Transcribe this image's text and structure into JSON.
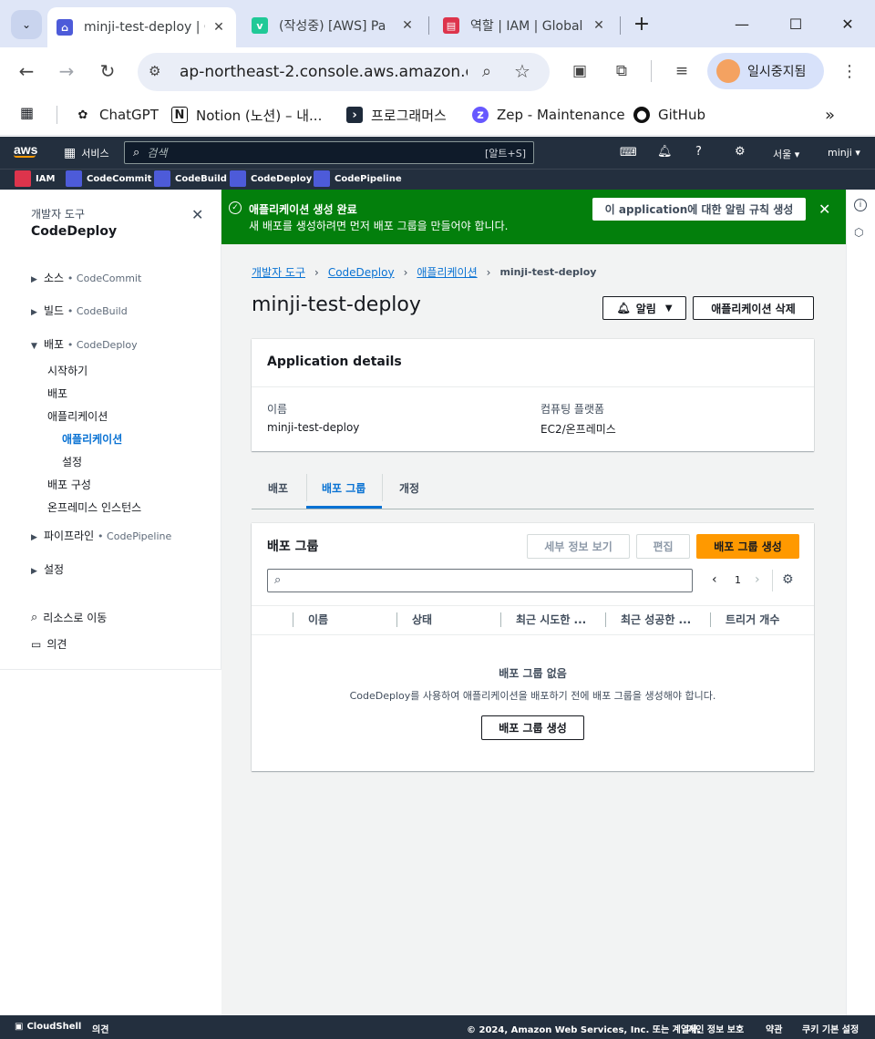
{
  "browser": {
    "tabs": [
      {
        "title": "minji-test-deploy | CodeDeploy",
        "active": true
      },
      {
        "title": "(작성중) [AWS] Pa"
      },
      {
        "title": "역할 | IAM | Global"
      }
    ],
    "url": "ap-northeast-2.console.aws.amazon.c...",
    "profile_label": "일시중지됨",
    "bookmarks": [
      {
        "label": "ChatGPT"
      },
      {
        "label": "Notion (노션) – 내..."
      },
      {
        "label": "프로그래머스"
      },
      {
        "label": "Zep - Maintenance"
      },
      {
        "label": "GitHub"
      }
    ]
  },
  "aws_header": {
    "logo": "aws",
    "services_label": "서비스",
    "search_placeholder": "검색",
    "search_shortcut": "[알트+S]",
    "region": "서울 ▾",
    "user": "minji ▾"
  },
  "favorites": [
    {
      "label": "IAM",
      "color": "#dd344c"
    },
    {
      "label": "CodeCommit",
      "color": "#4d5bd9"
    },
    {
      "label": "CodeBuild",
      "color": "#4d5bd9"
    },
    {
      "label": "CodeDeploy",
      "color": "#4d5bd9"
    },
    {
      "label": "CodePipeline",
      "color": "#4d5bd9"
    }
  ],
  "sidenav": {
    "eyebrow": "개발자 도구",
    "title": "CodeDeploy",
    "sections": [
      {
        "label": "소스",
        "sub": "CodeCommit"
      },
      {
        "label": "빌드",
        "sub": "CodeBuild"
      },
      {
        "label": "배포",
        "sub": "CodeDeploy"
      }
    ],
    "deploy_items": [
      "시작하기",
      "배포",
      "애플리케이션"
    ],
    "app_subitems": [
      "애플리케이션",
      "설정"
    ],
    "deploy_items2": [
      "배포 구성",
      "온프레미스 인스턴스"
    ],
    "sections2": [
      {
        "label": "파이프라인",
        "sub": "CodePipeline"
      },
      {
        "label": "설정",
        "sub": ""
      }
    ],
    "goto": "리소스로 이동",
    "feedback": "의견"
  },
  "flash": {
    "title": "애플리케이션 생성 완료",
    "message": "새 배포를 생성하려면 먼저 배포 그룹을 만들어야 합니다.",
    "button": "이 application에 대한 알림 규칙 생성"
  },
  "breadcrumb": [
    "개발자 도구",
    "CodeDeploy",
    "애플리케이션",
    "minji-test-deploy"
  ],
  "page": {
    "title": "minji-test-deploy",
    "notify_button": "알림",
    "delete_button": "애플리케이션 삭제"
  },
  "details": {
    "header": "Application details",
    "name_label": "이름",
    "name_value": "minji-test-deploy",
    "platform_label": "컴퓨팅 플랫폼",
    "platform_value": "EC2/온프레미스"
  },
  "tabs": [
    {
      "label": "배포"
    },
    {
      "label": "배포 그룹",
      "active": true
    },
    {
      "label": "개정"
    }
  ],
  "groups": {
    "header": "배포 그룹",
    "view_details": "세부 정보 보기",
    "edit": "편집",
    "create": "배포 그룹 생성",
    "page": "1",
    "columns": [
      "이름",
      "상태",
      "최근 시도한 ...",
      "최근 성공한 ...",
      "트리거 개수"
    ],
    "empty_title": "배포 그룹 없음",
    "empty_message": "CodeDeploy를 사용하여 애플리케이션을 배포하기 전에 배포 그룹을 생성해야 합니다.",
    "empty_button": "배포 그룹 생성"
  },
  "footer": {
    "cloudshell": "CloudShell",
    "feedback": "의견",
    "copyright": "© 2024, Amazon Web Services, Inc. 또는 계열사.",
    "privacy": "개인 정보 보호",
    "terms": "약관",
    "cookies": "쿠키 기본 설정"
  },
  "colors": {
    "success": "#037f0c",
    "primary": "#ff9900",
    "link": "#0972d3",
    "aws_nav": "#232f3e"
  }
}
